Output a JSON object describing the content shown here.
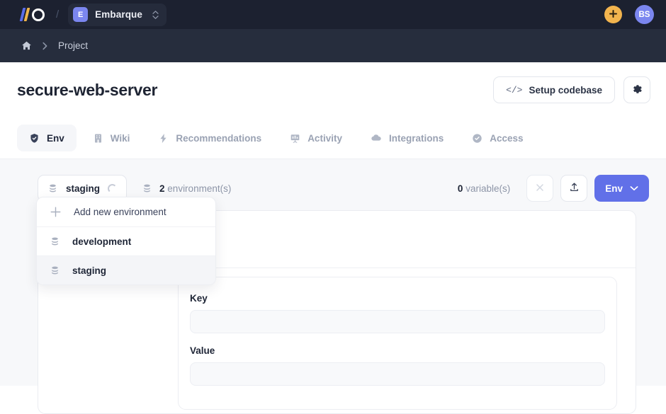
{
  "topbar": {
    "logo_name": "infinity-logo",
    "divider": "/",
    "org_initial": "E",
    "org_name": "Embarque",
    "switcher_icon": "chevron-up-down-icon",
    "add_button_icon": "plus-icon",
    "avatar_initials": "BS"
  },
  "breadcrumb": {
    "home_icon": "home-icon",
    "separator_icon": "chevron-right-icon",
    "label": "Project"
  },
  "title_row": {
    "title": "secure-web-server",
    "setup_codebase_label": "Setup codebase",
    "setup_codebase_icon": "code-icon",
    "settings_icon": "gear-icon"
  },
  "tabs": [
    {
      "label": "Env",
      "icon": "shield-check-icon",
      "active": true
    },
    {
      "label": "Wiki",
      "icon": "book-icon",
      "active": false
    },
    {
      "label": "Recommendations",
      "icon": "bolt-icon",
      "active": false
    },
    {
      "label": "Activity",
      "icon": "presentation-icon",
      "active": false
    },
    {
      "label": "Integrations",
      "icon": "cloud-icon",
      "active": false
    },
    {
      "label": "Access",
      "icon": "badge-check-icon",
      "active": false
    }
  ],
  "toolbar": {
    "env_selected": "staging",
    "env_icon": "database-icon",
    "loading_icon": "spinner-icon",
    "env_count_number": "2",
    "env_count_label": "environment(s)",
    "env_count_icon": "database-icon",
    "variable_count_number": "0",
    "variable_count_label": "variable(s)",
    "clear_icon": "close-x-icon",
    "upload_icon": "upload-icon",
    "primary_label": "Env",
    "primary_caret_icon": "chevron-down-icon"
  },
  "dropdown": {
    "items": [
      {
        "label": "Add new environment",
        "icon": "plus-icon",
        "highlighted": false,
        "strong": false
      },
      {
        "label": "development",
        "icon": "database-icon",
        "highlighted": false,
        "strong": true
      },
      {
        "label": "staging",
        "icon": "database-icon",
        "highlighted": true,
        "strong": true
      }
    ]
  },
  "form": {
    "key_label": "Key",
    "key_value": "",
    "value_label": "Value",
    "value_value": ""
  },
  "colors": {
    "topbar_bg": "#1c2130",
    "breadcrumb_bg": "#262d3d",
    "content_bg": "#f7f8fa",
    "accent_purple": "#6170e8",
    "accent_amber": "#f2b44e",
    "logo_blue": "#5a6ce8",
    "logo_gold": "#f0b54a"
  }
}
